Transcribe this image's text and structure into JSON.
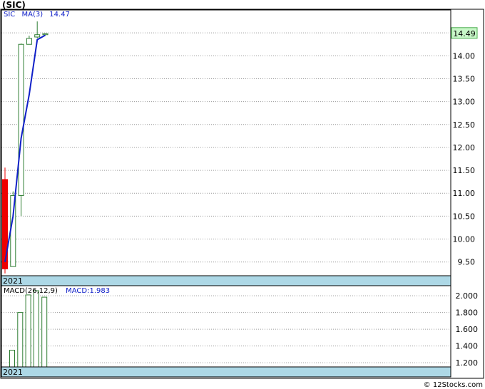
{
  "title": "(SIC)",
  "credit": "© 12Stocks.com",
  "colors": {
    "up": "#2e7d32",
    "down": "#ee0000",
    "ma": "#1020c8",
    "band": "#add8e6",
    "grid": "#9a9a9a",
    "last_label_bg": "#c8f7c8",
    "macd_text": "#1020c8"
  },
  "chart_data": [
    {
      "type": "candlestick",
      "ticker": "SIC",
      "legend": {
        "ticker": "SIC",
        "ma_label": "MA(3)",
        "ma_value": "14.47"
      },
      "ylim": [
        9.2,
        15.0
      ],
      "y_ticks": [
        {
          "v": 9.5,
          "label": "9.50"
        },
        {
          "v": 10.0,
          "label": "10.00"
        },
        {
          "v": 10.5,
          "label": "10.50"
        },
        {
          "v": 11.0,
          "label": "11.00"
        },
        {
          "v": 11.5,
          "label": "11.50"
        },
        {
          "v": 12.0,
          "label": "12.00"
        },
        {
          "v": 12.5,
          "label": "12.50"
        },
        {
          "v": 13.0,
          "label": "13.00"
        },
        {
          "v": 13.5,
          "label": "13.50"
        },
        {
          "v": 14.0,
          "label": "14.00"
        },
        {
          "v": 14.5,
          "label": "14.50"
        }
      ],
      "last_price": 14.49,
      "last_price_label": "14.49",
      "x_label": "2021",
      "candles": [
        {
          "open": 11.3,
          "high": 11.56,
          "low": 9.25,
          "close": 9.35
        },
        {
          "open": 9.4,
          "high": 11.04,
          "low": 9.4,
          "close": 10.95
        },
        {
          "open": 10.95,
          "high": 14.27,
          "low": 10.5,
          "close": 14.25
        },
        {
          "open": 14.25,
          "high": 14.44,
          "low": 14.25,
          "close": 14.38
        },
        {
          "open": 14.41,
          "high": 14.75,
          "low": 14.38,
          "close": 14.46
        },
        {
          "open": 14.46,
          "high": 14.49,
          "low": 14.45,
          "close": 14.48
        }
      ],
      "ma": [
        9.5,
        10.5,
        12.2,
        13.15,
        14.35,
        14.45
      ]
    },
    {
      "type": "bar",
      "name": "MACD",
      "legend": {
        "label": "MACD(26,12,9)",
        "value_label": "MACD:1.983"
      },
      "ylim": [
        1.15,
        2.12
      ],
      "y_ticks": [
        {
          "v": 1.2,
          "label": "1.200"
        },
        {
          "v": 1.4,
          "label": "1.400"
        },
        {
          "v": 1.6,
          "label": "1.600"
        },
        {
          "v": 1.8,
          "label": "1.800"
        },
        {
          "v": 2.0,
          "label": "2.000"
        }
      ],
      "x_label": "2021",
      "values": [
        1.35,
        1.8,
        2.01,
        2.06,
        1.983
      ]
    }
  ]
}
